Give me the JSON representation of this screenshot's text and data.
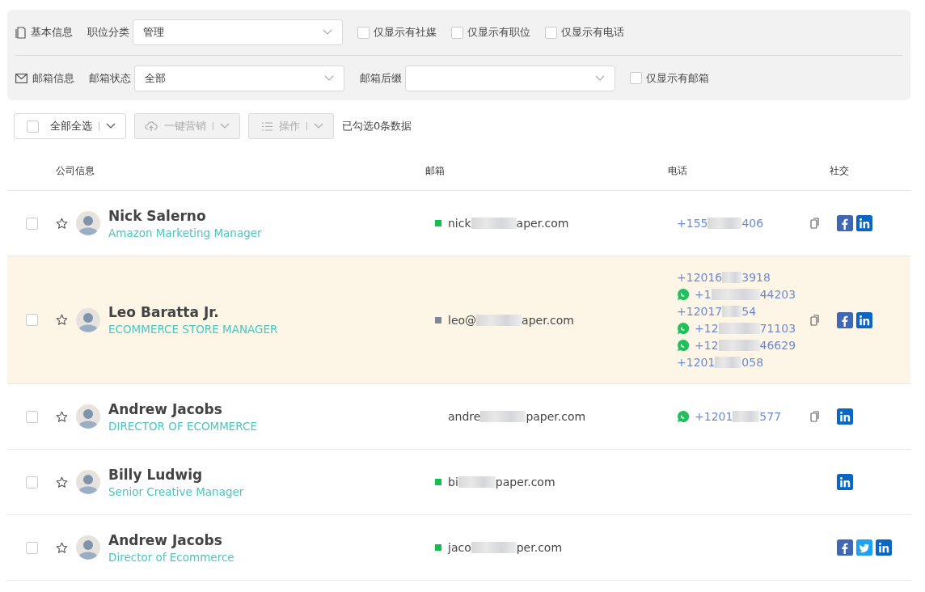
{
  "filters": {
    "basic": {
      "label": "基本信息",
      "field_label": "职位分类",
      "value": "管理",
      "checkboxes": [
        {
          "label": "仅显示有社媒",
          "checked": false
        },
        {
          "label": "仅显示有职位",
          "checked": false
        },
        {
          "label": "仅显示有电话",
          "checked": false
        }
      ]
    },
    "email": {
      "label": "邮箱信息",
      "field_label": "邮箱状态",
      "value": "全部",
      "suffix_label": "邮箱后缀",
      "checkboxes": [
        {
          "label": "仅显示有邮箱",
          "checked": false
        }
      ]
    }
  },
  "toolbar": {
    "select_all": {
      "label": "全部全选",
      "checked": false
    },
    "marketing": {
      "label": "一键营销",
      "disabled": true
    },
    "actions": {
      "label": "操作",
      "disabled": true
    },
    "status": "已勾选0条数据"
  },
  "table": {
    "columns": [
      "公司信息",
      "邮箱",
      "电话",
      "社交"
    ],
    "rows": [
      {
        "checked": false,
        "starred": false,
        "highlighted": false,
        "name": "Nick Salerno",
        "title": "Amazon Marketing Manager",
        "email": {
          "start": "nick",
          "end": "aper.com",
          "color": "#13c04b"
        },
        "phones": [
          {
            "start": "+155",
            "end": "406",
            "whatsapp": false
          }
        ],
        "social": [
          {
            "kind": "facebook"
          },
          {
            "kind": "linkedin"
          }
        ]
      },
      {
        "checked": false,
        "starred": false,
        "highlighted": true,
        "name": "Leo Baratta Jr.",
        "title": "ECOMMERCE STORE MANAGER",
        "email": {
          "start": "leo@",
          "end": "aper.com",
          "color": "#7f8694"
        },
        "phones": [
          {
            "start": "+12016",
            "end": "3918",
            "whatsapp": false
          },
          {
            "start": "+1",
            "end": "44203",
            "whatsapp": true
          },
          {
            "start": "+12017",
            "end": "54",
            "whatsapp": false
          },
          {
            "start": "+12",
            "end": "71103",
            "whatsapp": true
          },
          {
            "start": "+12",
            "end": "46629",
            "whatsapp": true
          },
          {
            "start": "+1201",
            "end": "058",
            "whatsapp": false
          }
        ],
        "social": [
          {
            "kind": "facebook"
          },
          {
            "kind": "linkedin"
          }
        ]
      },
      {
        "checked": false,
        "starred": false,
        "highlighted": false,
        "name": "Andrew Jacobs",
        "title": "DIRECTOR OF ECOMMERCE",
        "email": {
          "start": "andre",
          "end": "paper.com"
        },
        "phones": [
          {
            "start": "+1201",
            "end": "577",
            "whatsapp": true
          }
        ],
        "social": [
          {
            "kind": "linkedin"
          }
        ]
      },
      {
        "checked": false,
        "starred": false,
        "highlighted": false,
        "name": "Billy Ludwig",
        "title": "Senior Creative Manager",
        "email": {
          "start": "bi",
          "end": "paper.com",
          "color": "#13c04b"
        },
        "phones": [],
        "social": [
          {
            "kind": "linkedin"
          }
        ]
      },
      {
        "checked": false,
        "starred": false,
        "highlighted": false,
        "name": "Andrew Jacobs",
        "title": "Director of Ecommerce",
        "email": {
          "start": "jaco",
          "end": "per.com",
          "color": "#13c04b"
        },
        "phones": [],
        "social": [
          {
            "kind": "facebook"
          },
          {
            "kind": "twitter"
          },
          {
            "kind": "linkedin"
          }
        ]
      }
    ]
  }
}
